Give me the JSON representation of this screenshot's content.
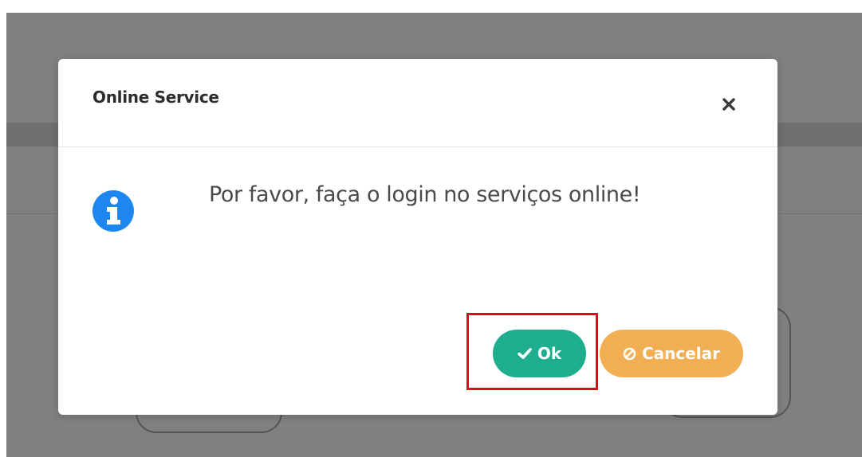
{
  "dialog": {
    "title": "Online Service",
    "close_icon": "close-icon",
    "message": "Por favor, faça o login no serviços online!",
    "info_icon": "info-circle-icon",
    "ok_label": "Ok",
    "ok_icon": "check-icon",
    "cancel_label": "Cancelar",
    "cancel_icon": "ban-icon"
  },
  "colors": {
    "overlay": "#808080",
    "ok_button": "#1fae8d",
    "cancel_button": "#f2ae52",
    "info_icon": "#1e86f0",
    "highlight": "#e8001c"
  }
}
